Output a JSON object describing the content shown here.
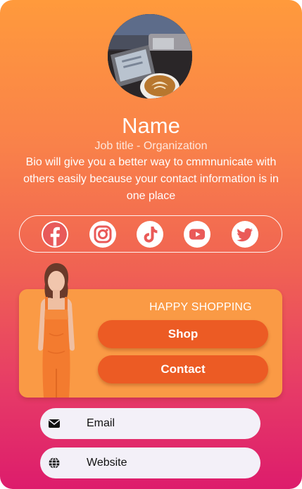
{
  "profile": {
    "name": "Name",
    "job_title": "Job title - Organization",
    "bio": "Bio will give you a better way to cmmnunicate with others easily because your contact information is in one place"
  },
  "social": [
    {
      "icon": "facebook-icon"
    },
    {
      "icon": "instagram-icon"
    },
    {
      "icon": "tiktok-icon"
    },
    {
      "icon": "youtube-icon"
    },
    {
      "icon": "twitter-icon"
    }
  ],
  "promo": {
    "title": "HAPPY SHOPPING",
    "shop_label": "Shop",
    "contact_label": "Contact"
  },
  "links": {
    "email_label": "Email",
    "website_label": "Website"
  },
  "colors": {
    "gradient_top": "#ff9a3c",
    "gradient_bottom": "#dd1c6c",
    "promo_card": "#fa9a45",
    "promo_button": "#ec5b24",
    "link_pill": "#f3f0f8"
  }
}
